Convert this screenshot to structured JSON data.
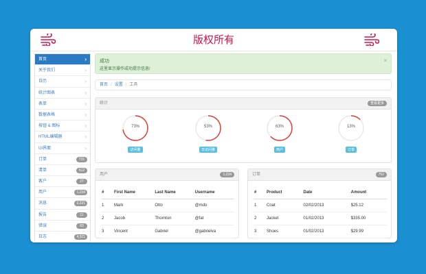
{
  "header": {
    "title": "版权所有"
  },
  "sidebar": {
    "items": [
      {
        "label": "首页",
        "active": true
      },
      {
        "label": "关于我们"
      },
      {
        "label": "日历"
      },
      {
        "label": "统计图表"
      },
      {
        "label": "表单"
      },
      {
        "label": "数据表格"
      },
      {
        "label": "按钮 & 图标"
      },
      {
        "label": "HTML编辑器"
      },
      {
        "label": "UI界面"
      },
      {
        "label": "订单",
        "badge": "731"
      },
      {
        "label": "清单",
        "badge": "612"
      },
      {
        "label": "客户",
        "badge": "27"
      },
      {
        "label": "用户",
        "badge": "1,234"
      },
      {
        "label": "消息",
        "badge": "2,221"
      },
      {
        "label": "报告",
        "badge": "11"
      },
      {
        "label": "错误",
        "badge": "83"
      },
      {
        "label": "日志",
        "badge": "4,321"
      }
    ]
  },
  "alert": {
    "title": "成功",
    "text": "这里显示操作成功提示信息!",
    "close": "×"
  },
  "breadcrumb": {
    "items": [
      "首页",
      "设置",
      "工具"
    ]
  },
  "stats": {
    "title": "统计",
    "badge": "查看更多",
    "gauges": [
      {
        "value": 73,
        "label": "73%",
        "tag": "访问量"
      },
      {
        "value": 53,
        "label": "53%",
        "tag": "日访问量"
      },
      {
        "value": 63,
        "label": "63%",
        "tag": "用户"
      },
      {
        "value": 13,
        "label": "13%",
        "tag": "订单"
      }
    ]
  },
  "users_panel": {
    "title": "用户",
    "badge": "1,234",
    "columns": [
      "#",
      "First Name",
      "Last Name",
      "Username"
    ],
    "rows": [
      [
        "1",
        "Mark",
        "Otto",
        "@mdo"
      ],
      [
        "2",
        "Jacob",
        "Thornton",
        "@fat"
      ],
      [
        "3",
        "Vincent",
        "Gabriel",
        "@gabrielva"
      ]
    ]
  },
  "orders_panel": {
    "title": "订单",
    "badge": "752",
    "columns": [
      "#",
      "Product",
      "Date",
      "Amount"
    ],
    "rows": [
      [
        "1",
        "Coat",
        "02/02/2013",
        "$25.12"
      ],
      [
        "2",
        "Jacket",
        "01/02/2013",
        "$335.00"
      ],
      [
        "3",
        "Shoes",
        "01/02/2013",
        "$29.99"
      ]
    ]
  },
  "colors": {
    "background": "#1a8fd1",
    "brand": "#d0134a",
    "accent": "#2b7bc4",
    "gauge": "#e53935",
    "tag": "#5bc0de"
  },
  "icons": {
    "logo": "wind-logo-icon",
    "chevron": "chevron-right-icon",
    "close": "close-icon"
  }
}
